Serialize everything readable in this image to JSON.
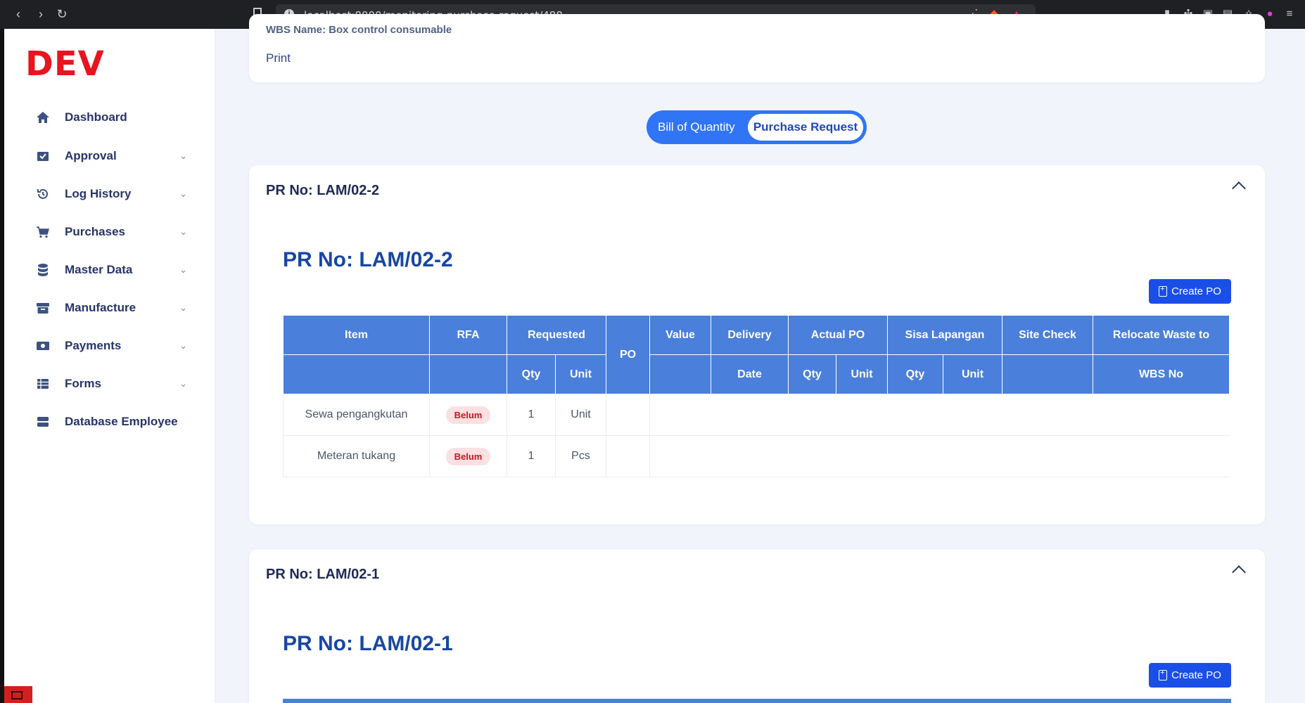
{
  "browser": {
    "url": "localhost:8000/monitoring-purchase-request/488"
  },
  "brand": "DEV",
  "sidebar": {
    "items": [
      {
        "label": "Dashboard",
        "icon": "home-icon",
        "has_children": false
      },
      {
        "label": "Approval",
        "icon": "inbox-check-icon",
        "has_children": true
      },
      {
        "label": "Log History",
        "icon": "history-icon",
        "has_children": true
      },
      {
        "label": "Purchases",
        "icon": "cart-icon",
        "has_children": true
      },
      {
        "label": "Master Data",
        "icon": "database-icon",
        "has_children": true
      },
      {
        "label": "Manufacture",
        "icon": "archive-box-icon",
        "has_children": true
      },
      {
        "label": "Payments",
        "icon": "cash-icon",
        "has_children": true
      },
      {
        "label": "Forms",
        "icon": "list-table-icon",
        "has_children": true
      },
      {
        "label": "Database Employee",
        "icon": "server-icon",
        "has_children": false
      }
    ]
  },
  "top_card": {
    "wbs_name": "WBS Name: Box control consumable",
    "print_label": "Print"
  },
  "toggle": {
    "options": [
      "Bill of Quantity",
      "Purchase Request"
    ],
    "active": "Purchase Request"
  },
  "colors": {
    "accent": "#2f75f5",
    "table_header": "#4a7fdb",
    "button": "#1a4ee8",
    "badge_bg": "#fde0e2",
    "badge_text": "#c4161c",
    "brand": "#e8141e"
  },
  "table_headers": {
    "row1": [
      "Item",
      "RFA",
      "Requested",
      "PO",
      "Value",
      "Delivery",
      "Actual PO",
      "Sisa Lapangan",
      "Site Check",
      "Relocate Waste to"
    ],
    "row2": [
      "Qty",
      "Unit",
      "Date",
      "Qty",
      "Unit",
      "Qty",
      "Unit",
      "WBS No"
    ]
  },
  "purchase_requests": [
    {
      "header": "PR No: LAM/02-2",
      "title": "PR No: LAM/02-2",
      "create_po_label": "Create PO",
      "rows": [
        {
          "item": "Sewa pengangkutan",
          "rfa": "Belum",
          "qty": "1",
          "unit": "Unit"
        },
        {
          "item": "Meteran tukang",
          "rfa": "Belum",
          "qty": "1",
          "unit": "Pcs"
        }
      ]
    },
    {
      "header": "PR No: LAM/02-1",
      "title": "PR No: LAM/02-1",
      "create_po_label": "Create PO",
      "rows": []
    }
  ]
}
